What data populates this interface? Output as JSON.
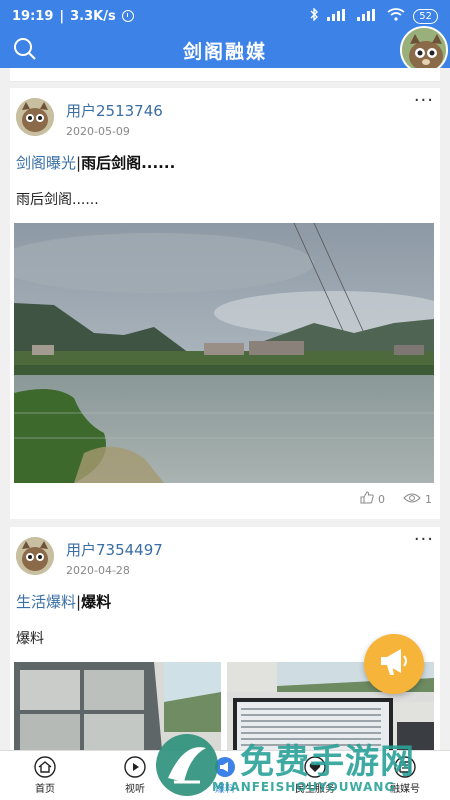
{
  "status_bar": {
    "time": "19:19",
    "speed": "3.3K/s",
    "battery": "52"
  },
  "header": {
    "title": "剑阁融媒"
  },
  "posts": [
    {
      "user": "用户2513746",
      "date": "2020-05-09",
      "category": "剑阁曝光",
      "separator": "|",
      "title": "雨后剑阁......",
      "summary": "雨后剑阁......",
      "likes": "0",
      "views": "1"
    },
    {
      "user": "用户7354497",
      "date": "2020-04-28",
      "category": "生活爆料",
      "separator": "|",
      "title": "爆料",
      "summary": "爆料"
    }
  ],
  "more_label": "···",
  "tabs": [
    {
      "label": "首页",
      "icon": "home-icon"
    },
    {
      "label": "视听",
      "icon": "play-icon"
    },
    {
      "label": "爆料",
      "icon": "broadcast-icon"
    },
    {
      "label": "民生服务",
      "icon": "heart-icon"
    },
    {
      "label": "融媒号",
      "icon": "tablet-icon"
    }
  ],
  "watermark": {
    "text": "免费手游网",
    "sub": "MIANFEISHOUYOUWANG"
  },
  "colors": {
    "brand_blue": "#3d82e6",
    "link_blue": "#3a6ea5",
    "fab_orange": "#f6b43a"
  }
}
